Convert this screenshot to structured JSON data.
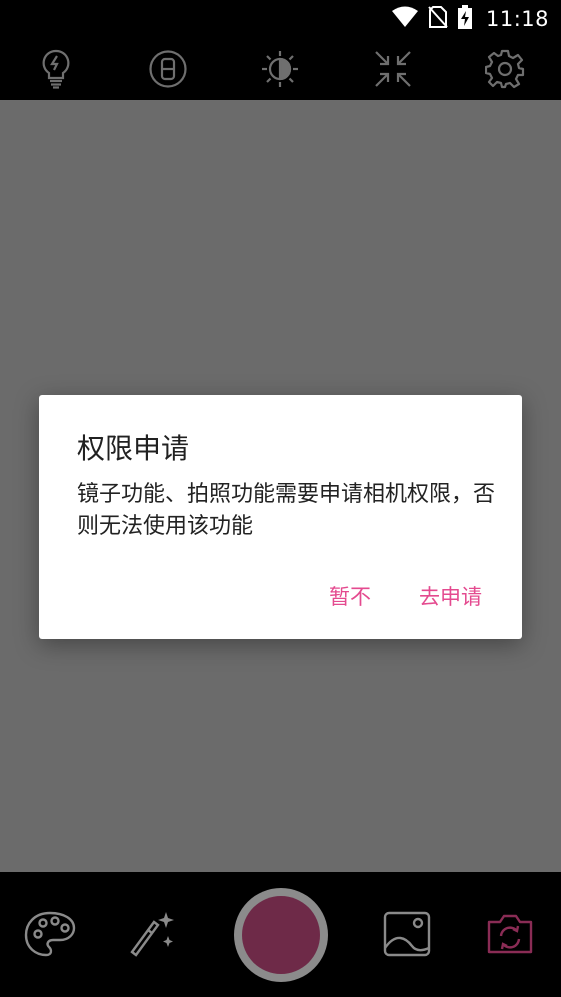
{
  "status_bar": {
    "time": "11:18",
    "icons": [
      "wifi-icon",
      "no-sim-icon",
      "battery-charging-icon"
    ]
  },
  "top_toolbar": {
    "icons": [
      "flash-bulb-icon",
      "timer-icon",
      "brightness-icon",
      "collapse-icon",
      "settings-gear-icon"
    ]
  },
  "dialog": {
    "title": "权限申请",
    "message": "镜子功能、拍照功能需要申请相机权限，否则无法使用该功能",
    "negative_button": "暂不",
    "positive_button": "去申请"
  },
  "bottom_bar": {
    "icons": [
      "palette-icon",
      "magic-wand-icon",
      "shutter-button",
      "gallery-icon",
      "switch-camera-icon"
    ]
  },
  "colors": {
    "accent": "#e44a8f",
    "shutter_fill": "#6e2a48",
    "preview_bg": "#6b6b6b",
    "bar_bg": "#000000"
  }
}
